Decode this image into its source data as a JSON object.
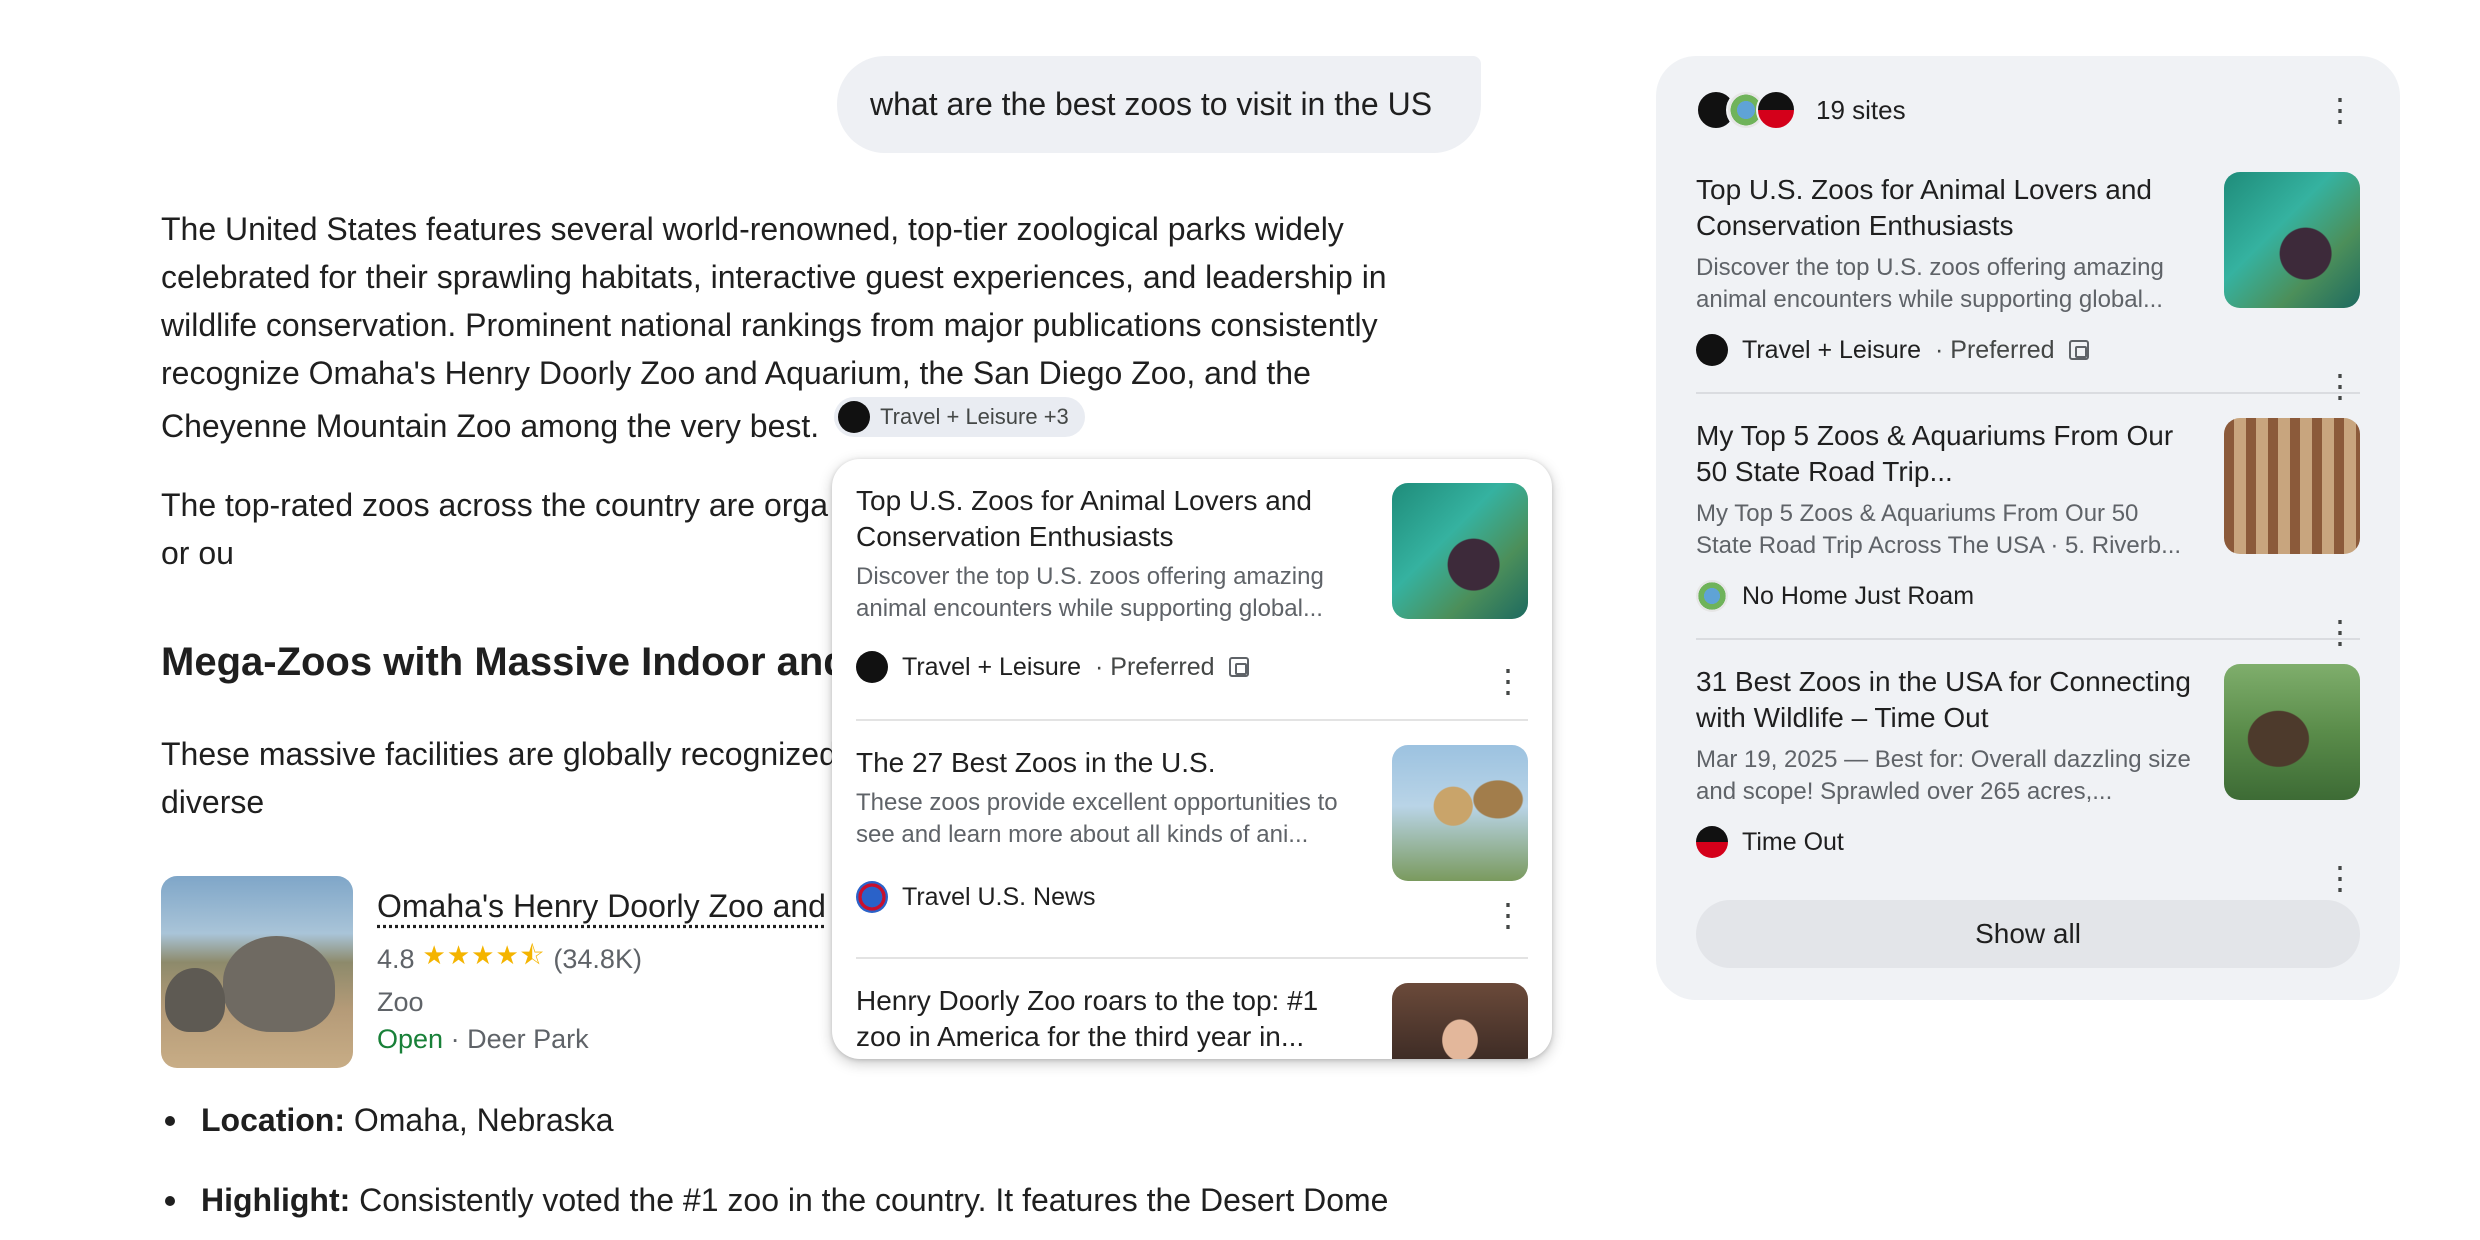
{
  "query": "what are the best zoos to visit in the US",
  "answer": {
    "intro": "The United States features several world-renowned, top-tier zoological parks widely celebrated for their sprawling habitats, interactive guest experiences, and leadership in wildlife conservation. Prominent national rankings from major publications consistently recognize Omaha's Henry Doorly Zoo and Aquarium, the San Diego Zoo, and the Cheyenne Mountain Zoo among the very best.",
    "intro_chip": "Travel + Leisure +3",
    "para2": "The top-rated zoos across the country are orga to help you plan your next family vacation or ou",
    "section_heading": "Mega-Zoos with Massive Indoor and",
    "para3": "These massive facilities are globally recognized environments and housing hundreds of diverse",
    "place": {
      "title": "Omaha's Henry Doorly Zoo and",
      "rating": "4.8",
      "stars": "★★★★⯪",
      "reviews": "(34.8K)",
      "type": "Zoo",
      "status": "Open",
      "area": "· Deer Park"
    },
    "bullets": [
      {
        "label": "Location:",
        "text": " Omaha, Nebraska"
      },
      {
        "label": "Highlight:",
        "text": " Consistently voted the #1 zoo in the country. It features the Desert Dome"
      }
    ]
  },
  "popover": {
    "items": [
      {
        "title": "Top U.S. Zoos for Animal Lovers and Conservation Enthusiasts",
        "snippet": "Discover the top U.S. zoos offering amazing animal encounters while supporting global...",
        "source": "Travel + Leisure",
        "preferred": "· Preferred",
        "thumb": "aquarium-thumbnail"
      },
      {
        "title": "The 27 Best Zoos in the U.S.",
        "snippet": "These zoos provide excellent opportunities to see and learn more about all kinds of ani...",
        "source": "Travel U.S. News",
        "thumb": "giraffe-thumbnail"
      },
      {
        "title": "Henry Doorly Zoo roars to the top: #1 zoo in America for the third year in...",
        "thumb": "person-thumbnail"
      }
    ]
  },
  "sources_panel": {
    "count_label": "19 sites",
    "items": [
      {
        "title": "Top U.S. Zoos for Animal Lovers and Conservation Enthusiasts",
        "snippet": "Discover the top U.S. zoos offering amazing animal encounters while supporting global...",
        "source": "Travel + Leisure",
        "preferred": "· Preferred"
      },
      {
        "title": "My Top 5 Zoos & Aquariums From Our 50 State Road Trip...",
        "snippet": "My Top 5 Zoos & Aquariums From Our 50 State Road Trip Across The USA · 5. Riverb...",
        "source": "No Home Just Roam"
      },
      {
        "title": "31 Best Zoos in the USA for Connecting with Wildlife – Time Out",
        "snippet": "Mar 19, 2025 — Best for: Overall dazzling size and scope! Sprawled over 265 acres,...",
        "source": "Time Out"
      }
    ],
    "show_all": "Show all"
  },
  "colors": {
    "accent_open": "#188038",
    "star": "#f4b400",
    "panel_bg": "#f0f2f5",
    "bubble_bg": "#eef0f4"
  },
  "icons": {
    "more": "more-vert-icon",
    "copy": "copy-icon",
    "star": "star-icon"
  }
}
